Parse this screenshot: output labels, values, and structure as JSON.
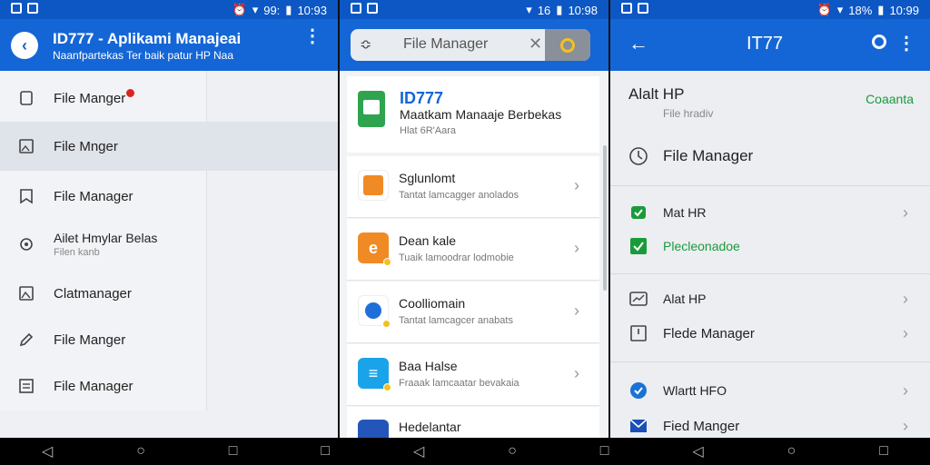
{
  "status": {
    "left": {
      "time1": "99:",
      "time1b": "10:93",
      "time2": "16",
      "time2b": "10:98",
      "time3": "18%",
      "time3b": "10:99"
    }
  },
  "screen1": {
    "title": "ID777 - Aplikami Manajeai",
    "subtitle": "Naanfpartekas Ter baik patur HP Naa",
    "menu": [
      {
        "label": "File Manger",
        "sub": ""
      },
      {
        "label": "File Mnger",
        "sub": ""
      },
      {
        "label": "File Manager",
        "sub": ""
      },
      {
        "label": "Ailet Hmylar Belas",
        "sub": "Filen kanb"
      },
      {
        "label": "Clatmanager",
        "sub": ""
      },
      {
        "label": "File Manger",
        "sub": ""
      },
      {
        "label": "File Manager",
        "sub": ""
      }
    ]
  },
  "screen2": {
    "search_placeholder": "File Manager",
    "header_card": {
      "title": "ID777",
      "subtitle": "Maatkam Manaaje Berbekas",
      "meta": "Hlat 6R'Aara"
    },
    "items": [
      {
        "title": "Sglunlomt",
        "sub": "Tantat lamcagger anolados",
        "color": "#f08a24"
      },
      {
        "title": "Dean kale",
        "sub": "Tuaik lamoodrar lodmobie",
        "color": "#f08a24"
      },
      {
        "title": "Coolliomain",
        "sub": "Tantat lamcagcer anabats",
        "color": "#1f6fd8"
      },
      {
        "title": "Baa Halse",
        "sub": "Fraaak lamcaatar bevakaia",
        "color": "#1aa3e8"
      },
      {
        "title": "Hedelantar",
        "sub": "",
        "color": "#2455b8"
      }
    ]
  },
  "screen3": {
    "title": "IT77",
    "section_title": "Alalt HP",
    "section_sub": "File hradiv",
    "section_action": "Coaanta",
    "file_manager": "File Manager",
    "rows": [
      {
        "label": "Mat HR",
        "green": false
      },
      {
        "label": "Plecleonadoe",
        "green": true
      },
      {
        "label": "Alat HP",
        "green": false
      },
      {
        "label": "Flede Manager",
        "green": false
      },
      {
        "label": "Wlartt HFO",
        "green": false
      },
      {
        "label": "Fied Manger",
        "green": false
      }
    ]
  },
  "colors": {
    "appbar": "#1466d6",
    "statusbar": "#0c57c4",
    "accent_green": "#1a9b3b"
  },
  "icons": [
    "back-icon",
    "more-icon",
    "search-icon",
    "close-icon",
    "filter-icon",
    "chevron-right-icon"
  ]
}
